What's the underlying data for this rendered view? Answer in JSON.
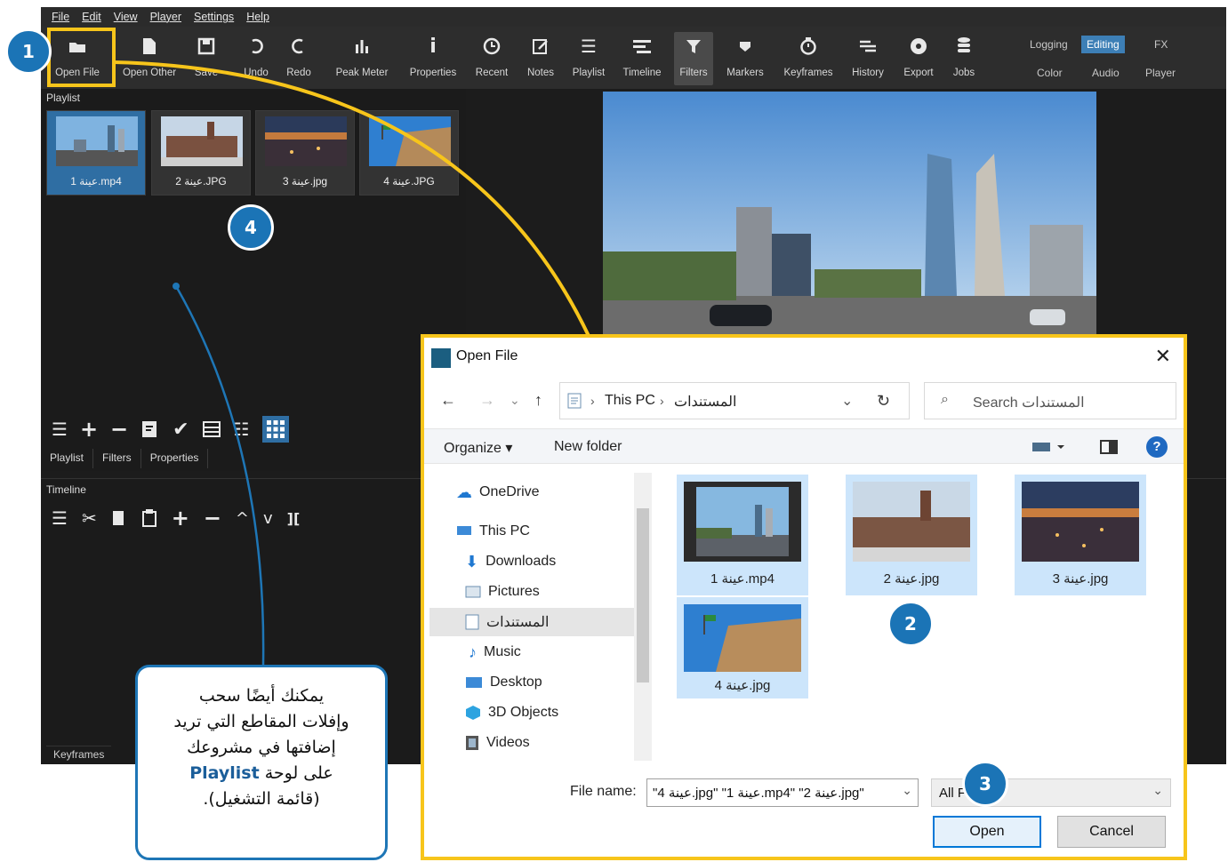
{
  "menubar": [
    "File",
    "Edit",
    "View",
    "Player",
    "Settings",
    "Help"
  ],
  "toolbar": {
    "items": [
      "Open File",
      "Open Other",
      "Save",
      "Undo",
      "Redo",
      "Peak Meter",
      "Properties",
      "Recent",
      "Notes",
      "Playlist",
      "Timeline",
      "Filters",
      "Markers",
      "Keyframes",
      "History",
      "Export",
      "Jobs"
    ],
    "layouts_top": [
      "Logging",
      "Editing",
      "FX"
    ],
    "layouts_bottom": [
      "Color",
      "Audio",
      "Player"
    ]
  },
  "playlist": {
    "title": "Playlist",
    "clips": [
      "1 عينة.mp4",
      "2 عينة.JPG",
      "3 عينة.jpg",
      "4 عينة.JPG"
    ],
    "tabs": [
      "Playlist",
      "Filters",
      "Properties"
    ]
  },
  "timeline": {
    "title": "Timeline",
    "bottom_tab": "Keyframes"
  },
  "dialog": {
    "title": "Open File",
    "breadcrumb": [
      "This PC",
      "المستندات"
    ],
    "search_placeholder": "Search المستندات",
    "organize": "Organize",
    "new_folder": "New folder",
    "nav": [
      "OneDrive",
      "This PC",
      "Downloads",
      "Pictures",
      "المستندات",
      "Music",
      "Desktop",
      "3D Objects",
      "Videos"
    ],
    "files": [
      "1 عينة.mp4",
      "2 عينة.jpg",
      "3 عينة.jpg",
      "4 عينة.jpg"
    ],
    "file_name_label": "File name:",
    "file_name_value": "\"4 عينة.jpg\" \"1 عينة.mp4\" \"2 عينة.jpg\"",
    "file_type": "All F",
    "open": "Open",
    "cancel": "Cancel"
  },
  "badges": [
    "1",
    "2",
    "3",
    "4"
  ],
  "callout": {
    "line1": "يمكنك أيضًا سحب",
    "line2": "وإفلات المقاطع التي تريد",
    "line3": "إضافتها في مشروعك",
    "line4_pre": "على لوحة",
    "line4_bold": "Playlist",
    "line5": "(قائمة التشغيل)."
  },
  "colors": {
    "accent": "#f7c51b",
    "badge": "#1b74b6",
    "selection": "#cce5fb",
    "app_bg": "#1c1c1c"
  }
}
